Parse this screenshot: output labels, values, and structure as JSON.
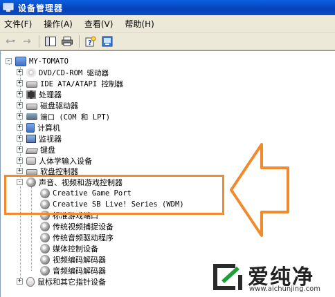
{
  "window": {
    "title": "设备管理器"
  },
  "menu": [
    {
      "label": "文件(F)"
    },
    {
      "label": "操作(A)"
    },
    {
      "label": "查看(V)"
    },
    {
      "label": "帮助(H)"
    }
  ],
  "toolbar": {
    "icons": [
      "back-arrow-icon",
      "forward-arrow-icon",
      "properties-pane-icon",
      "print-icon",
      "help-icon",
      "scan-hardware-icon"
    ]
  },
  "tree": {
    "root": {
      "label": "MY-TOMATO",
      "expander": "-"
    },
    "categories": [
      {
        "label": "DVD/CD-ROM 驱动器",
        "icon": "dvd-drive-icon",
        "expander": "+"
      },
      {
        "label": "IDE ATA/ATAPI 控制器",
        "icon": "ide-controller-icon",
        "expander": "+"
      },
      {
        "label": "处理器",
        "icon": "processor-icon",
        "expander": "+"
      },
      {
        "label": "磁盘驱动器",
        "icon": "disk-drive-icon",
        "expander": "+"
      },
      {
        "label": "端口 (COM 和 LPT)",
        "icon": "port-icon",
        "expander": "+"
      },
      {
        "label": "计算机",
        "icon": "computer-icon",
        "expander": "+"
      },
      {
        "label": "监视器",
        "icon": "monitor-icon",
        "expander": "+"
      },
      {
        "label": "键盘",
        "icon": "keyboard-icon",
        "expander": "+"
      },
      {
        "label": "人体学输入设备",
        "icon": "hid-icon",
        "expander": "+"
      },
      {
        "label": "软盘控制器",
        "icon": "floppy-controller-icon",
        "expander": "+"
      }
    ],
    "sound": {
      "label": "声音、视频和游戏控制器",
      "expander": "-",
      "children": [
        {
          "label": "Creative Game Port"
        },
        {
          "label": "Creative SB Live! Series (WDM)"
        },
        {
          "label": "标准游戏端口"
        },
        {
          "label": "传统视频捕捉设备"
        },
        {
          "label": "传统音频驱动程序"
        },
        {
          "label": "媒体控制设备"
        },
        {
          "label": "视频编码解码器"
        },
        {
          "label": "音频编码解码器"
        }
      ]
    },
    "last": {
      "label": "鼠标和其它指针设备",
      "icon": "mouse-icon",
      "expander": "+"
    }
  },
  "annotation": {
    "highlight_color": "#f08a2c"
  },
  "watermark": {
    "text": "爱纯净",
    "url": "www.aichunjing.com"
  }
}
